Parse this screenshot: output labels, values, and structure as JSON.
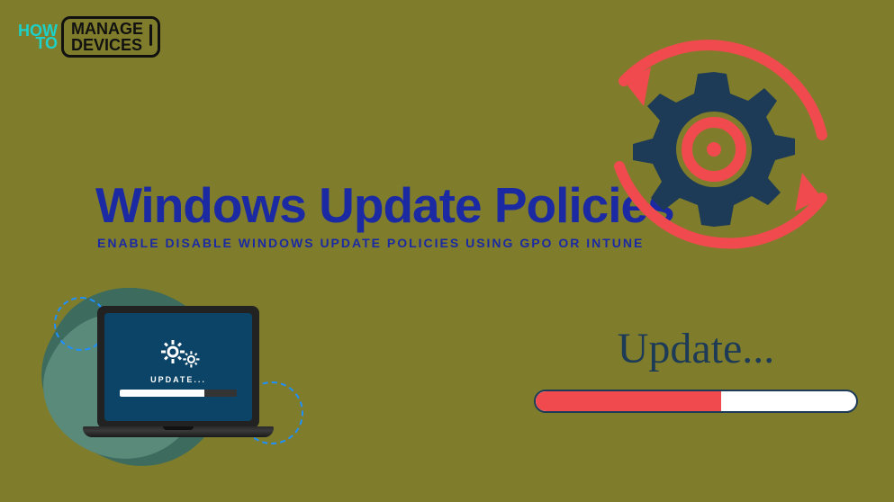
{
  "logo": {
    "how": "HOW",
    "to": "TO",
    "manage": "MANAGE",
    "devices": "DEVICES"
  },
  "title": "Windows Update Policies",
  "subtitle": "ENABLE DISABLE WINDOWS UPDATE POLICIES USING GPO OR INTUNE",
  "laptop": {
    "label": "UPDATE...",
    "progress_pct": 72
  },
  "update": {
    "label": "Update...",
    "progress_pct": 58
  },
  "colors": {
    "background": "#7f7d2b",
    "primary_blue": "#1b2aa3",
    "gear_navy": "#1d3a57",
    "accent_red": "#f04a4f",
    "teal": "#1dd1c8"
  }
}
